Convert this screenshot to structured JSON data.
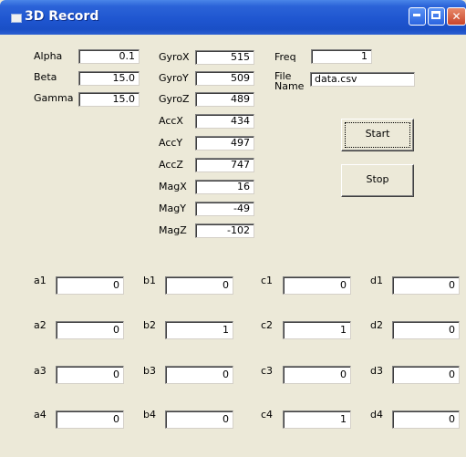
{
  "window": {
    "title": "3D Record"
  },
  "angles": [
    {
      "label": "Alpha",
      "value": "0.1"
    },
    {
      "label": "Beta",
      "value": "15.0"
    },
    {
      "label": "Gamma",
      "value": "15.0"
    }
  ],
  "sensors": [
    {
      "label": "GyroX",
      "value": "515"
    },
    {
      "label": "GyroY",
      "value": "509"
    },
    {
      "label": "GyroZ",
      "value": "489"
    },
    {
      "label": "AccX",
      "value": "434"
    },
    {
      "label": "AccY",
      "value": "497"
    },
    {
      "label": "AccZ",
      "value": "747"
    },
    {
      "label": "MagX",
      "value": "16"
    },
    {
      "label": "MagY",
      "value": "-49"
    },
    {
      "label": "MagZ",
      "value": "-102"
    }
  ],
  "freq": {
    "label": "Freq",
    "value": "1"
  },
  "file": {
    "label_line1": "File",
    "label_line2": "Name",
    "value": "data.csv"
  },
  "buttons": {
    "start": "Start",
    "stop": "Stop"
  },
  "grid": {
    "a": [
      {
        "label": "a1",
        "value": "0"
      },
      {
        "label": "a2",
        "value": "0"
      },
      {
        "label": "a3",
        "value": "0"
      },
      {
        "label": "a4",
        "value": "0"
      }
    ],
    "b": [
      {
        "label": "b1",
        "value": "0"
      },
      {
        "label": "b2",
        "value": "1"
      },
      {
        "label": "b3",
        "value": "0"
      },
      {
        "label": "b4",
        "value": "0"
      }
    ],
    "c": [
      {
        "label": "c1",
        "value": "0"
      },
      {
        "label": "c2",
        "value": "1"
      },
      {
        "label": "c3",
        "value": "0"
      },
      {
        "label": "c4",
        "value": "1"
      }
    ],
    "d": [
      {
        "label": "d1",
        "value": "0"
      },
      {
        "label": "d2",
        "value": "0"
      },
      {
        "label": "d3",
        "value": "0"
      },
      {
        "label": "d4",
        "value": "0"
      }
    ]
  }
}
